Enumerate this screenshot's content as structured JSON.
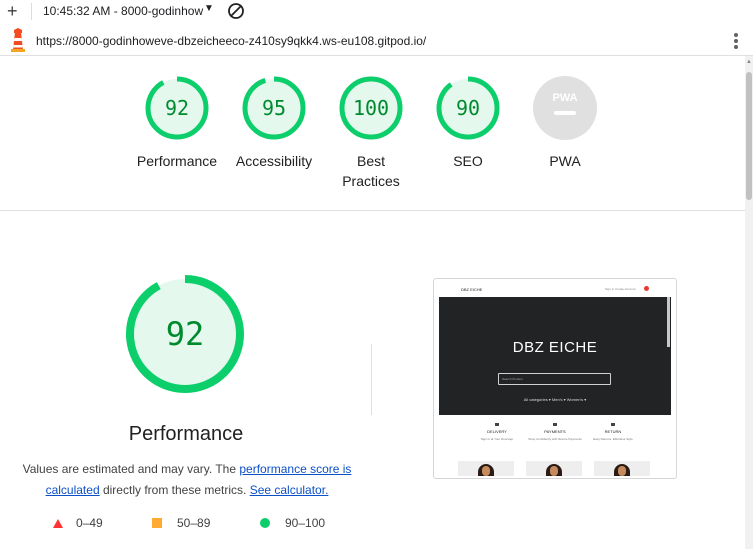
{
  "toolbar": {
    "new_tab_icon": "plus-icon",
    "title": "10:45:32 AM - 8000-godinhow",
    "dropdown_icon": "caret-down-icon",
    "block_icon": "no-entry-icon"
  },
  "urlbar": {
    "logo_icon": "lighthouse-icon",
    "url": "https://8000-godinhoweve-dbzeicheeco-z410sy9qkk4.ws-eu108.gitpod.io/",
    "menu_icon": "kebab-menu-icon"
  },
  "colors": {
    "pass_green": "#0cce6b",
    "pass_fill": "#e5f8ee",
    "pass_text": "#008a2e",
    "average_orange": "#ffaa33",
    "fail_red": "#ff3333",
    "pwa_gray": "#e0e0e0",
    "link_blue": "#0c50c7"
  },
  "categories": [
    {
      "score": "92",
      "label": "Performance",
      "fraction": 0.92
    },
    {
      "score": "95",
      "label": "Accessibility",
      "fraction": 0.95
    },
    {
      "score": "100",
      "label": "Best Practices",
      "fraction": 1.0
    },
    {
      "score": "90",
      "label": "SEO",
      "fraction": 0.9
    },
    {
      "score": "",
      "label": "PWA",
      "badge_text": "PWA"
    }
  ],
  "performance": {
    "score": "92",
    "fraction": 0.92,
    "title": "Performance",
    "desc_prefix": "Values are estimated and may vary. The",
    "link_score": "performance score is calculated",
    "desc_middle": "directly from these metrics.",
    "link_calc": "See calculator."
  },
  "legend": [
    {
      "shape": "triangle",
      "range": "0–49"
    },
    {
      "shape": "square",
      "range": "50–89"
    },
    {
      "shape": "circle",
      "range": "90–100"
    }
  ],
  "screenshot": {
    "brand": "DBZ EICHE",
    "nav_links": "Sign in   Create Account",
    "hero_title": "DBZ EICHE",
    "search_placeholder": "Search Product",
    "categories": "All categories ▾    Men's ▾    Women's ▾",
    "features": [
      {
        "title": "DELIVERY",
        "text": "Sign in at Your Doorstep"
      },
      {
        "title": "PAYMENTS",
        "text": "Shop Confidently with Secure Payments"
      },
      {
        "title": "RETURN",
        "text": "Easy Returns, Effortless Style"
      }
    ]
  }
}
